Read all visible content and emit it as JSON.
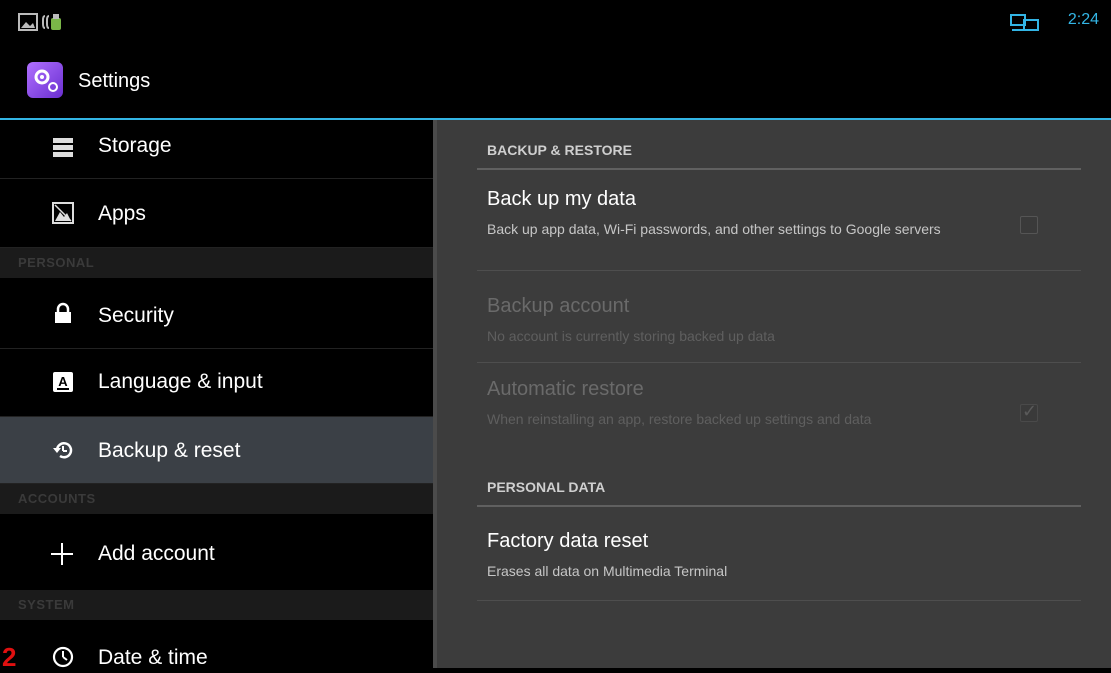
{
  "status": {
    "time": "2:24"
  },
  "app": {
    "title": "Settings"
  },
  "sidebar": {
    "items": [
      {
        "label": "Storage"
      },
      {
        "label": "Apps"
      },
      {
        "label": "Security"
      },
      {
        "label": "Language & input"
      },
      {
        "label": "Backup & reset"
      },
      {
        "label": "Add account"
      },
      {
        "label": "Date & time"
      }
    ],
    "headers": [
      "PERSONAL",
      "ACCOUNTS",
      "SYSTEM"
    ],
    "selected": "Backup & reset"
  },
  "main": {
    "sections": [
      {
        "header": "BACKUP & RESTORE"
      },
      {
        "header": "PERSONAL DATA"
      }
    ],
    "prefs": [
      {
        "title": "Back up my data",
        "summary": "Back up app data, Wi-Fi passwords, and other settings to Google servers",
        "checked": false
      },
      {
        "title": "Backup account",
        "summary": "No account is currently storing backed up data"
      },
      {
        "title": "Automatic restore",
        "summary": "When reinstalling an app, restore backed up settings and data",
        "checked": true
      },
      {
        "title": "Factory data reset",
        "summary": "Erases all data on Multimedia Terminal"
      }
    ]
  },
  "annotation": "2",
  "colors": {
    "accent": "#33b5e5",
    "selected_row": "#3b4046",
    "pane": "#3c3c3c"
  }
}
